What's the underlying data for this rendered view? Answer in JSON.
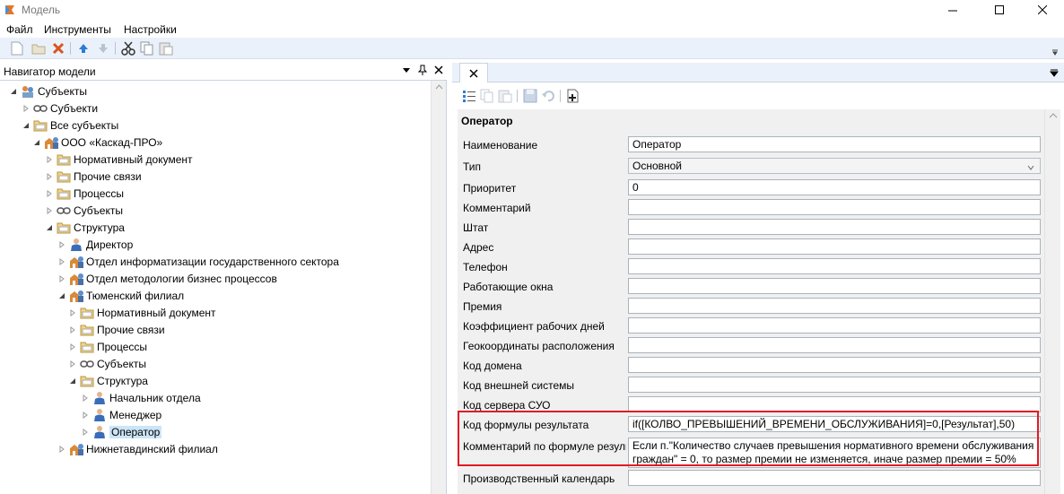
{
  "window": {
    "title": "Модель",
    "controls": [
      "minimize-icon",
      "maximize-icon",
      "close-icon"
    ]
  },
  "menu": [
    "Файл",
    "Инструменты",
    "Настройки"
  ],
  "toolbar": {
    "buttons": [
      "new-icon",
      "open-icon",
      "delete-icon",
      "arrow-up-icon",
      "arrow-down-icon",
      "cut-icon",
      "copy-icon",
      "paste-icon"
    ]
  },
  "navigator": {
    "title": "Навигатор модели",
    "tree": [
      {
        "label": "Субъекты",
        "level": 0,
        "expanded": true,
        "icon": "subjects-icon"
      },
      {
        "label": "Субъекти",
        "level": 1,
        "expanded": false,
        "icon": "link-icon"
      },
      {
        "label": "Все субъекты",
        "level": 1,
        "expanded": true,
        "icon": "folder-icon"
      },
      {
        "label": "ООО «Каскад-ПРО»",
        "level": 2,
        "expanded": true,
        "icon": "org-icon"
      },
      {
        "label": "Нормативный документ",
        "level": 3,
        "expanded": false,
        "icon": "folder-icon"
      },
      {
        "label": "Прочие связи",
        "level": 3,
        "expanded": false,
        "icon": "folder-icon"
      },
      {
        "label": "Процессы",
        "level": 3,
        "expanded": false,
        "icon": "folder-icon"
      },
      {
        "label": "Субъекты",
        "level": 3,
        "expanded": false,
        "icon": "link-icon"
      },
      {
        "label": "Структура",
        "level": 3,
        "expanded": true,
        "icon": "folder-icon"
      },
      {
        "label": "Директор",
        "level": 4,
        "expanded": false,
        "icon": "person-icon"
      },
      {
        "label": "Отдел информатизации государственного сектора",
        "level": 4,
        "expanded": false,
        "icon": "org-icon"
      },
      {
        "label": "Отдел методологии бизнес процессов",
        "level": 4,
        "expanded": false,
        "icon": "org-icon"
      },
      {
        "label": "Тюменский филиал",
        "level": 4,
        "expanded": true,
        "icon": "org-icon"
      },
      {
        "label": "Нормативный документ",
        "level": 5,
        "expanded": false,
        "icon": "folder-icon"
      },
      {
        "label": "Прочие связи",
        "level": 5,
        "expanded": false,
        "icon": "folder-icon"
      },
      {
        "label": "Процессы",
        "level": 5,
        "expanded": false,
        "icon": "folder-icon"
      },
      {
        "label": "Субъекты",
        "level": 5,
        "expanded": false,
        "icon": "link-icon"
      },
      {
        "label": "Структура",
        "level": 5,
        "expanded": true,
        "icon": "folder-icon"
      },
      {
        "label": "Начальник отдела",
        "level": 6,
        "expanded": false,
        "icon": "person-icon"
      },
      {
        "label": "Менеджер",
        "level": 6,
        "expanded": false,
        "icon": "person-icon"
      },
      {
        "label": "Оператор",
        "level": 6,
        "expanded": false,
        "icon": "person-icon",
        "selected": true
      },
      {
        "label": "Нижнетавдинский филиал",
        "level": 4,
        "expanded": false,
        "icon": "org-icon"
      }
    ]
  },
  "properties": {
    "header": "Оператор",
    "rows": [
      {
        "label": "Наименование",
        "value": "Оператор"
      },
      {
        "label": "Тип",
        "value": "Основной",
        "combo": true
      },
      {
        "label": "Приоритет",
        "value": "0"
      },
      {
        "label": "Комментарий",
        "value": ""
      },
      {
        "label": "Штат",
        "value": ""
      },
      {
        "label": "Адрес",
        "value": ""
      },
      {
        "label": "Телефон",
        "value": ""
      },
      {
        "label": "Работающие окна",
        "value": ""
      },
      {
        "label": "Премия",
        "value": ""
      },
      {
        "label": "Коэффициент рабочих дней",
        "value": ""
      },
      {
        "label": "Геокоординаты расположения",
        "value": ""
      },
      {
        "label": "Код домена",
        "value": ""
      },
      {
        "label": "Код внешней системы",
        "value": ""
      },
      {
        "label": "Код сервера СУО",
        "value": ""
      },
      {
        "label": "Код формулы результата",
        "value": "if([КОЛВО_ПРЕВЫШЕНИЙ_ВРЕМЕНИ_ОБСЛУЖИВАНИЯ]=0,[Результат],50)"
      },
      {
        "label": "Комментарий по формуле результата",
        "value_lines": [
          "Если п.\"Количество случаев превышения нормативного времени обслуживания",
          "граждан\" = 0,  то размер премии не изменяется, иначе размер премии = 50%"
        ]
      },
      {
        "label": "Производственный календарь",
        "value": ""
      }
    ]
  },
  "colors": {
    "toolbar_bg": "#eaf1fa",
    "highlight": "#e01b24",
    "selected": "#cce4f7"
  }
}
